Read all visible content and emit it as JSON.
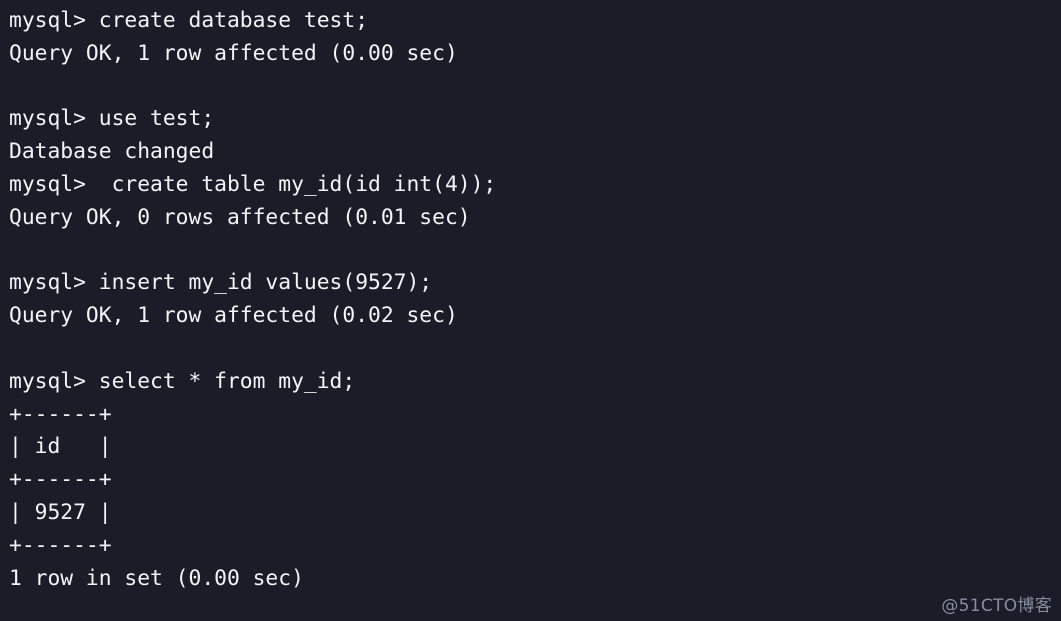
{
  "terminal": {
    "background_color": "#1a1d28",
    "text_color": "#f2f4f8",
    "prompt": "mysql>",
    "lines": [
      "mysql> create database test;",
      "Query OK, 1 row affected (0.00 sec)",
      "",
      "mysql> use test;",
      "Database changed",
      "mysql>  create table my_id(id int(4));",
      "Query OK, 0 rows affected (0.01 sec)",
      "",
      "mysql> insert my_id values(9527);",
      "Query OK, 1 row affected (0.02 sec)",
      "",
      "mysql> select * from my_id;",
      "+------+",
      "| id   |",
      "+------+",
      "| 9527 |",
      "+------+",
      "1 row in set (0.00 sec)"
    ]
  },
  "watermark": {
    "text": "@51CTO博客",
    "color": "#878d9c"
  }
}
